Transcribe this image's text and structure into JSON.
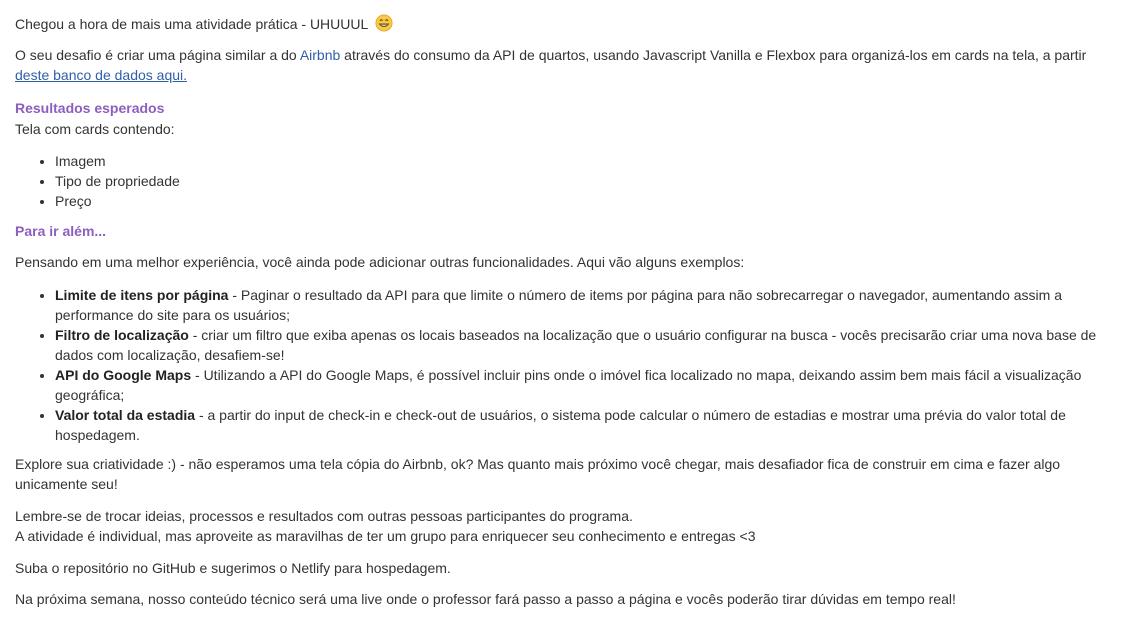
{
  "intro": {
    "headline": "Chegou a hora de mais uma atividade prática - UHUUUL",
    "emoji": "grinning-face-icon"
  },
  "challenge": {
    "text_before_link": "O seu desafio é criar uma página similar a do ",
    "airbnb_link": "Airbnb",
    "text_after_link": " através do consumo da API de quartos, usando Javascript Vanilla e Flexbox para organizá-los em cards na tela, a partir",
    "database_link": "deste banco de dados aqui."
  },
  "expected": {
    "title": "Resultados esperados",
    "subtitle": "Tela com cards contendo:",
    "items": [
      "Imagem",
      "Tipo de propriedade",
      "Preço"
    ]
  },
  "beyond": {
    "title": "Para ir além...",
    "intro": "Pensando em uma melhor experiência, você ainda pode adicionar outras funcionalidades. Aqui vão alguns exemplos:",
    "items": [
      {
        "label": "Limite de itens por página",
        "line1": " - Paginar o resultado da API para que limite o número de items por página para não sobrecarregar o navegador, aumentando assim a",
        "line2": "performance do site para os usuários;"
      },
      {
        "label": "Filtro de localização",
        "line1": " - criar um filtro que exiba apenas os locais baseados na localização que o usuário configurar na busca - vocês precisarão criar uma nova base de",
        "line2": "dados com localização, desafiem-se!"
      },
      {
        "label": "API do Google Maps",
        "line1": " - Utilizando a API do Google Maps, é possível incluir pins onde o imóvel fica localizado no mapa, deixando assim bem mais fácil a visualização",
        "line2": "geográfica;"
      },
      {
        "label": "Valor total da estadia",
        "line1": " - a partir do input de check-in e check-out de usuários, o sistema pode calcular o número de estadias e mostrar uma prévia do valor total de",
        "line2": "hospedagem."
      }
    ]
  },
  "explore": {
    "line1": "Explore sua criatividade :) - não esperamos uma tela cópia do Airbnb, ok? Mas quanto mais próximo você chegar, mais desafiador fica de construir em cima e fazer algo",
    "line2": "unicamente seu!"
  },
  "reminder": {
    "line1": "Lembre-se de trocar ideias, processos e resultados com outras pessoas participantes do programa.",
    "line2": "A atividade é individual, mas aproveite as maravilhas de ter um grupo para enriquecer seu conhecimento e entregas <3"
  },
  "upload": "Suba o repositório no GitHub e sugerimos o Netlify para hospedagem.",
  "next_week": "Na próxima semana, nosso conteúdo técnico será uma live onde o professor fará passo a passo a página e vocês poderão tirar dúvidas em tempo real!",
  "colors": {
    "section_title": "#8c5fbf",
    "link": "#2f5fa8",
    "text": "#333333"
  }
}
